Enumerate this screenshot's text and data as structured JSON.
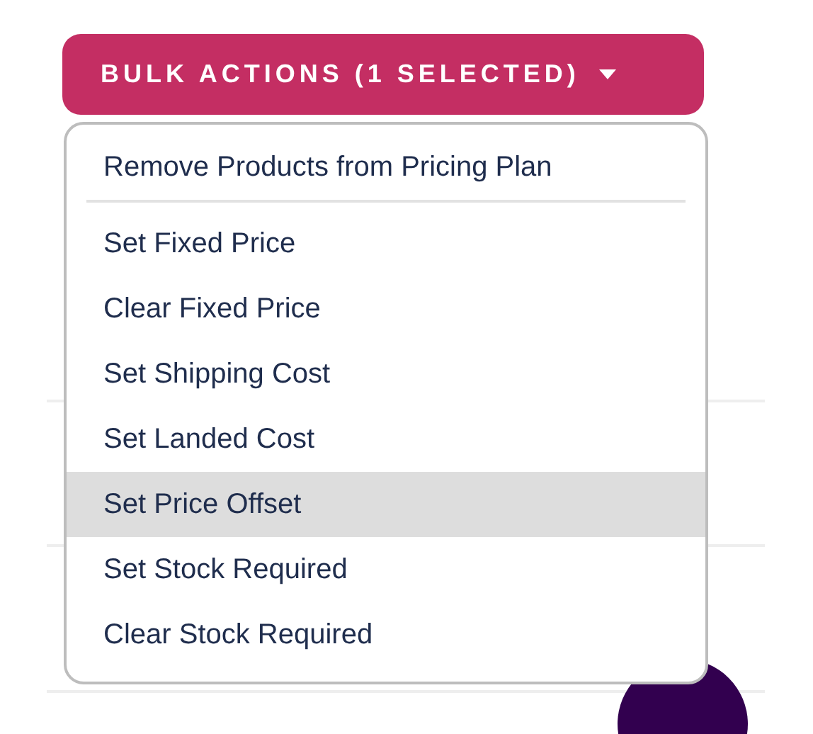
{
  "bulk_actions_button": {
    "label": "BULK ACTIONS (1 SELECTED)",
    "expanded": true
  },
  "menu_groups": [
    {
      "items": [
        {
          "label": "Remove Products from Pricing Plan",
          "selected": false
        }
      ]
    },
    {
      "items": [
        {
          "label": "Set Fixed Price",
          "selected": false
        },
        {
          "label": "Clear Fixed Price",
          "selected": false
        },
        {
          "label": "Set Shipping Cost",
          "selected": false
        },
        {
          "label": "Set Landed Cost",
          "selected": false
        },
        {
          "label": "Set Price Offset",
          "selected": true
        },
        {
          "label": "Set Stock Required",
          "selected": false
        },
        {
          "label": "Clear Stock Required",
          "selected": false
        }
      ]
    }
  ]
}
